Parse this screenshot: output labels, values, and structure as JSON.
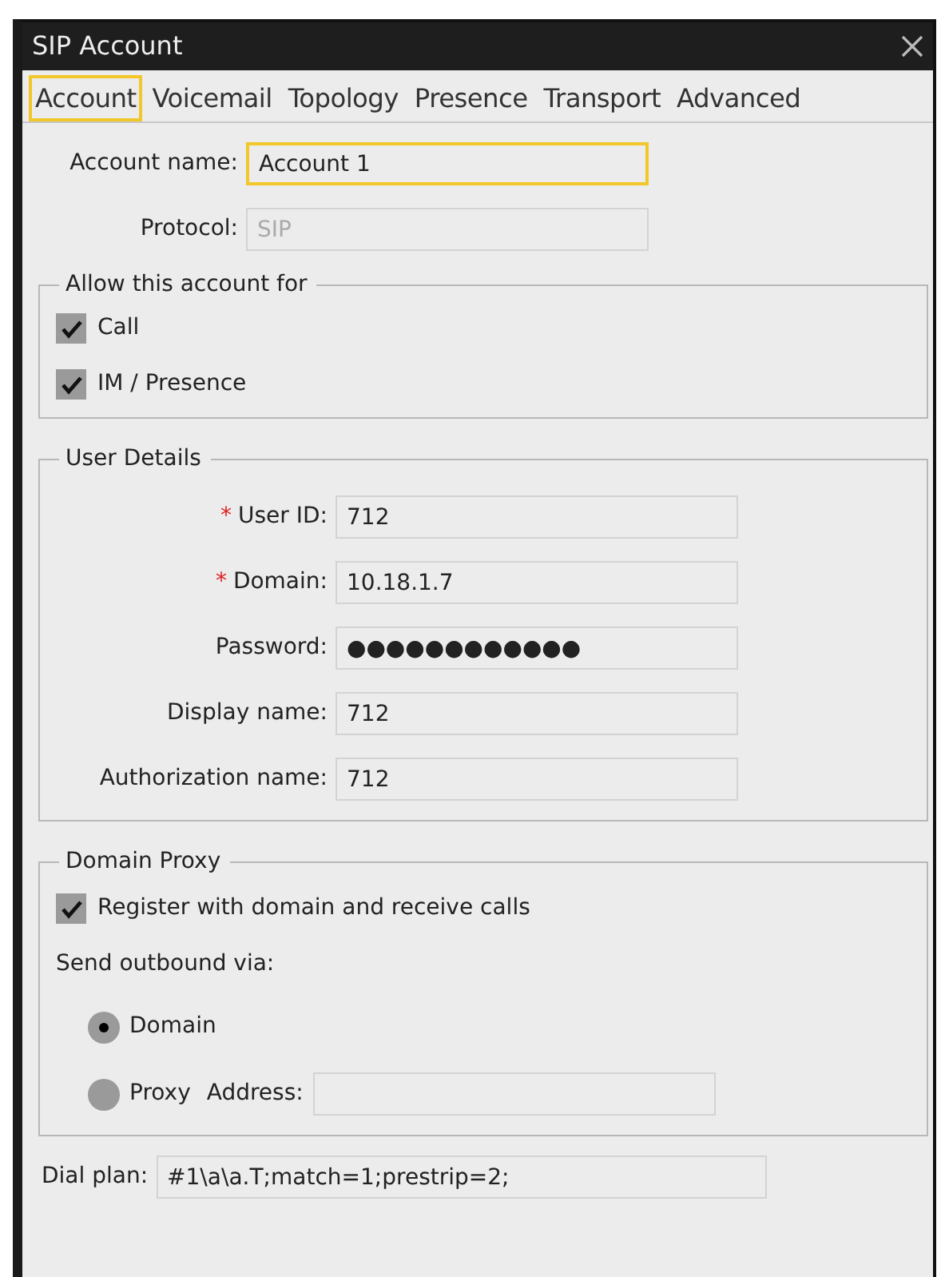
{
  "window": {
    "title": "SIP Account"
  },
  "tabs": [
    {
      "label": "Account",
      "selected": true
    },
    {
      "label": "Voicemail",
      "selected": false
    },
    {
      "label": "Topology",
      "selected": false
    },
    {
      "label": "Presence",
      "selected": false
    },
    {
      "label": "Transport",
      "selected": false
    },
    {
      "label": "Advanced",
      "selected": false
    }
  ],
  "account_name": {
    "label": "Account name:",
    "value": "Account 1",
    "focused": true
  },
  "protocol": {
    "label": "Protocol:",
    "value": "SIP",
    "disabled": true
  },
  "allow_group": {
    "title": "Allow this account for",
    "options": [
      {
        "label": "Call",
        "checked": true
      },
      {
        "label": "IM / Presence",
        "checked": true
      }
    ]
  },
  "user_details": {
    "title": "User Details",
    "fields": [
      {
        "marker": "*",
        "label": "User ID:",
        "value": "712"
      },
      {
        "marker": "*",
        "label": "Domain:",
        "value": "10.18.1.7"
      },
      {
        "label": "Password:",
        "value": "●●●●●●●●●●●●"
      },
      {
        "label": "Display name:",
        "value": "712"
      },
      {
        "label": "Authorization name:",
        "value": "712"
      }
    ]
  },
  "domain_proxy": {
    "title": "Domain Proxy",
    "register": {
      "label": "Register with domain and receive calls",
      "checked": true
    },
    "send_label": "Send outbound via:",
    "routes": [
      {
        "label": "Domain",
        "selected": true
      },
      {
        "label": "Proxy",
        "selected": false,
        "address_label": "Address:"
      }
    ]
  },
  "dial_plan": {
    "label": "Dial plan:",
    "value": "#1\\a\\a.T;match=1;prestrip=2;"
  }
}
